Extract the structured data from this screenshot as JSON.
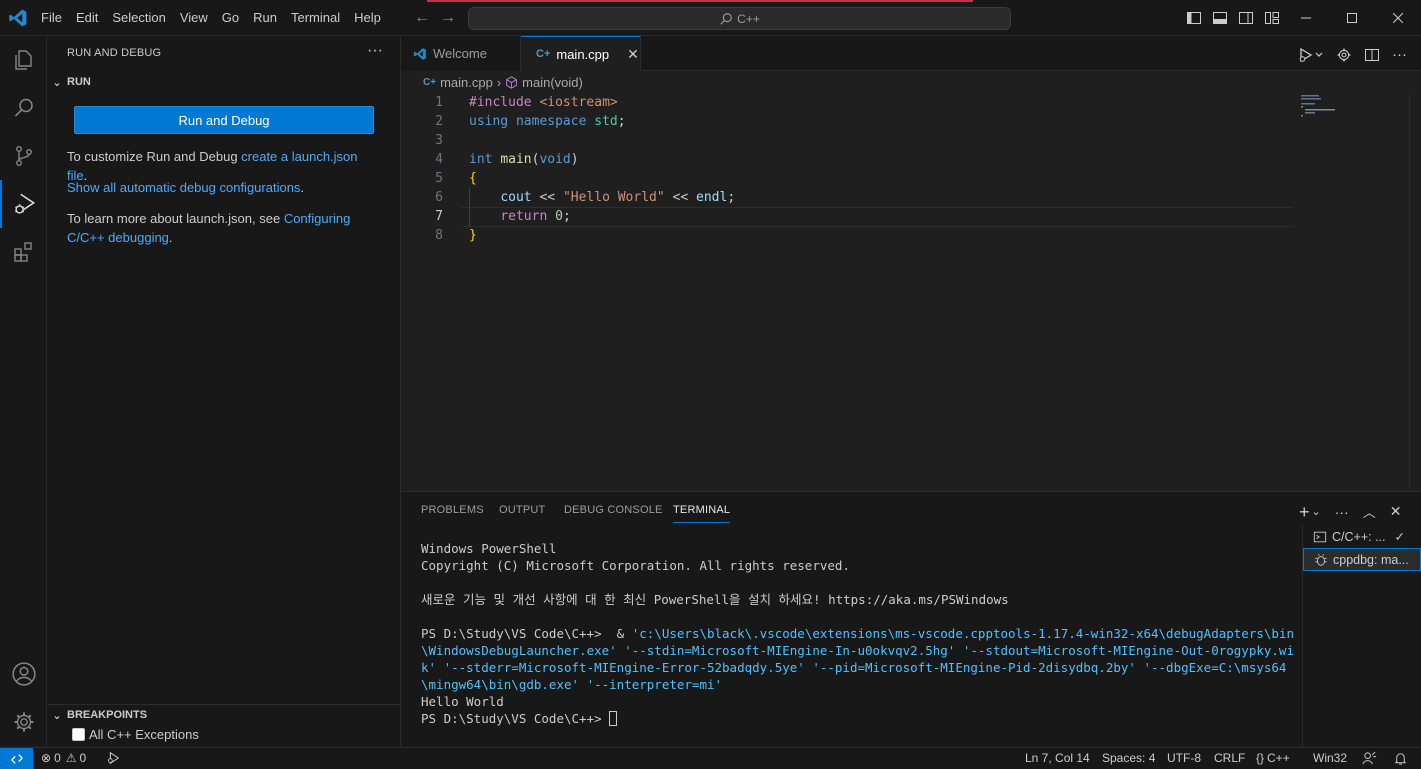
{
  "titlebar": {
    "menus": [
      "File",
      "Edit",
      "Selection",
      "View",
      "Go",
      "Run",
      "Terminal",
      "Help"
    ],
    "search_text": "C++"
  },
  "sidebar": {
    "title": "RUN AND DEBUG",
    "run_section": "RUN",
    "run_button": "Run and Debug",
    "customize_prefix": "To customize Run and Debug ",
    "customize_link": "create a launch.json file",
    "customize_suffix": ".",
    "show_all_link": "Show all automatic debug configurations",
    "show_all_suffix": ".",
    "learn_prefix": "To learn more about launch.json, see ",
    "learn_link": "Configuring C/C++ debugging",
    "learn_suffix": ".",
    "breakpoints_section": "BREAKPOINTS",
    "breakpoint_item": "All C++ Exceptions"
  },
  "tabs": [
    {
      "label": "Welcome",
      "active": false
    },
    {
      "label": "main.cpp",
      "active": true
    }
  ],
  "breadcrumb": {
    "file": "main.cpp",
    "symbol": "main(void)"
  },
  "editor": {
    "current_line": 7,
    "lines": [
      {
        "n": "1",
        "code": "#include <iostream>"
      },
      {
        "n": "2",
        "code": "using namespace std;"
      },
      {
        "n": "3",
        "code": ""
      },
      {
        "n": "4",
        "code": "int main(void)"
      },
      {
        "n": "5",
        "code": "{"
      },
      {
        "n": "6",
        "code": "    cout << \"Hello World\" << endl;"
      },
      {
        "n": "7",
        "code": "    return 0;"
      },
      {
        "n": "8",
        "code": "}"
      }
    ]
  },
  "panel": {
    "tabs": [
      "PROBLEMS",
      "OUTPUT",
      "DEBUG CONSOLE",
      "TERMINAL"
    ],
    "active_tab": "TERMINAL",
    "terminal_lines": [
      "Windows PowerShell",
      "Copyright (C) Microsoft Corporation. All rights reserved.",
      "",
      "새로운 기능 및 개선 사항에 대 한 최신 PowerShell을 설치 하세요! https://aka.ms/PSWindows",
      ""
    ],
    "prompt": "PS D:\\Study\\VS Code\\C++>",
    "command_amp": "  & ",
    "command": "'c:\\Users\\black\\.vscode\\extensions\\ms-vscode.cpptools-1.17.4-win32-x64\\debugAdapters\\bin\\WindowsDebugLauncher.exe' '--stdin=Microsoft-MIEngine-In-u0okvqv2.5hg' '--stdout=Microsoft-MIEngine-Out-0rogypky.wik' '--stderr=Microsoft-MIEngine-Error-52badqdy.5ye' '--pid=Microsoft-MIEngine-Pid-2disydbq.2by' '--dbgExe=C:\\msys64\\mingw64\\bin\\gdb.exe' '--interpreter=mi'",
    "output": "Hello World",
    "final_prompt": "PS D:\\Study\\VS Code\\C++>",
    "terminals": [
      {
        "label": "C/C++: ..."
      },
      {
        "label": "cppdbg: ma..."
      }
    ]
  },
  "statusbar": {
    "errors": "0",
    "warnings": "0",
    "position": "Ln 7, Col 14",
    "spaces": "Spaces: 4",
    "encoding": "UTF-8",
    "eol": "CRLF",
    "language": "C++",
    "platform": "Win32"
  },
  "colors": {
    "accent": "#0078d4",
    "background": "#1f1f1f",
    "sidebar": "#181818",
    "keyword_blue": "#569cd6",
    "control_purple": "#c586c0",
    "string": "#ce9178",
    "function": "#dcdcaa",
    "type": "#4ec9b0",
    "variable": "#9cdcfe",
    "number": "#b5cea8"
  },
  "icons": [
    "vscode-logo-icon",
    "explorer-icon",
    "search-icon",
    "source-control-icon",
    "run-debug-icon",
    "extensions-icon",
    "account-icon",
    "manage-gear-icon"
  ]
}
